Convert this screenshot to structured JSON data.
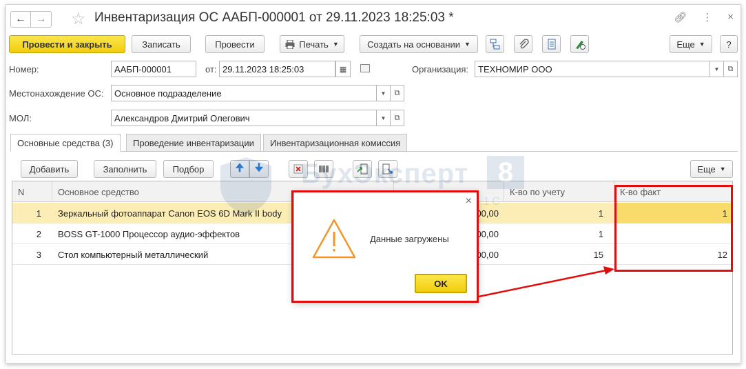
{
  "window": {
    "title": "Инвентаризация ОС ААБП-000001 от 29.11.2023 18:25:03 *"
  },
  "toolbar": {
    "post_close": "Провести и закрыть",
    "save": "Записать",
    "post": "Провести",
    "print": "Печать",
    "create_based": "Создать на основании",
    "more": "Еще",
    "help": "?"
  },
  "form": {
    "number_label": "Номер:",
    "number_value": "ААБП-000001",
    "date_label": "от:",
    "date_value": "29.11.2023 18:25:03",
    "org_label": "Организация:",
    "org_value": "ТЕХНОМИР ООО",
    "location_label": "Местонахождение ОС:",
    "location_value": "Основное подразделение",
    "mol_label": "МОЛ:",
    "mol_value": "Александров Дмитрий Олегович"
  },
  "tabs": [
    {
      "label": "Основные средства (3)"
    },
    {
      "label": "Проведение инвентаризации"
    },
    {
      "label": "Инвентаризационная комиссия"
    }
  ],
  "table_toolbar": {
    "add": "Добавить",
    "fill": "Заполнить",
    "select": "Подбор",
    "more": "Еще"
  },
  "table": {
    "columns": [
      "N",
      "Основное средство",
      "К-во по учету",
      "К-во факт"
    ],
    "rows": [
      {
        "n": "1",
        "asset": "Зеркальный фотоаппарат Canon EOS 6D Mark II body",
        "amount": "00,00",
        "qty_book": "1",
        "qty_fact": "1"
      },
      {
        "n": "2",
        "asset": "BOSS GT-1000 Процессор аудио-эффектов",
        "amount": "00,00",
        "qty_book": "1",
        "qty_fact": ""
      },
      {
        "n": "3",
        "asset": "Стол компьютерный металлический",
        "amount": "00,00",
        "qty_book": "15",
        "qty_fact": "12"
      }
    ]
  },
  "dialog": {
    "message": "Данные загружены",
    "ok": "OK",
    "close": "×"
  },
  "watermark": {
    "brand": "БухЭксперт",
    "digit": "8",
    "slogan": "База ответов по учету в 1С"
  },
  "colors": {
    "accent_yellow": "#f5d51c",
    "selection": "#fbedb5",
    "annotation_red": "#e10d0d"
  }
}
